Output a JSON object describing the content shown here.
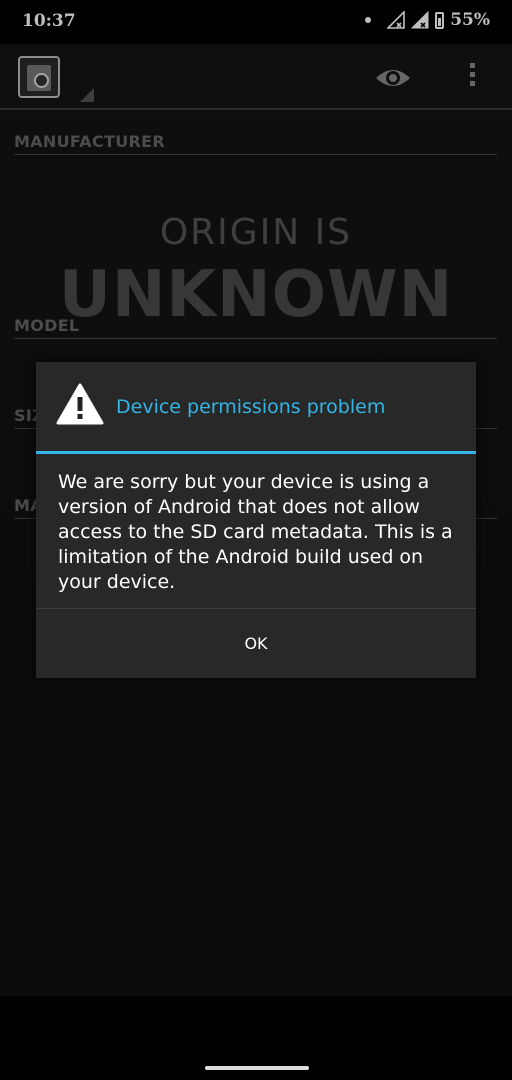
{
  "status_bar": {
    "time": "10:37",
    "battery": "55%",
    "icons": [
      "notification-dot-icon",
      "signal-no-data-icon",
      "signal-no-data-icon",
      "battery-icon"
    ]
  },
  "action_bar": {
    "app_icon": "sd-card-inspect-icon",
    "actions": [
      "eye-icon",
      "overflow-menu-icon"
    ]
  },
  "content": {
    "sections": {
      "manufacturer": "MANUFACTURER",
      "model": "MODEL",
      "size": "SIZE",
      "manufacture_date": "MA"
    },
    "origin_line1": "ORIGIN IS",
    "origin_line2": "UNKNOWN"
  },
  "dialog": {
    "title": "Device permissions problem",
    "icon": "warning-icon",
    "message": "We are sorry but your device is using a version of Android that does not allow access to the SD card metadata. This is a limitation of the Android build used on your device.",
    "ok_label": "OK",
    "accent_color": "#33b5e5"
  }
}
